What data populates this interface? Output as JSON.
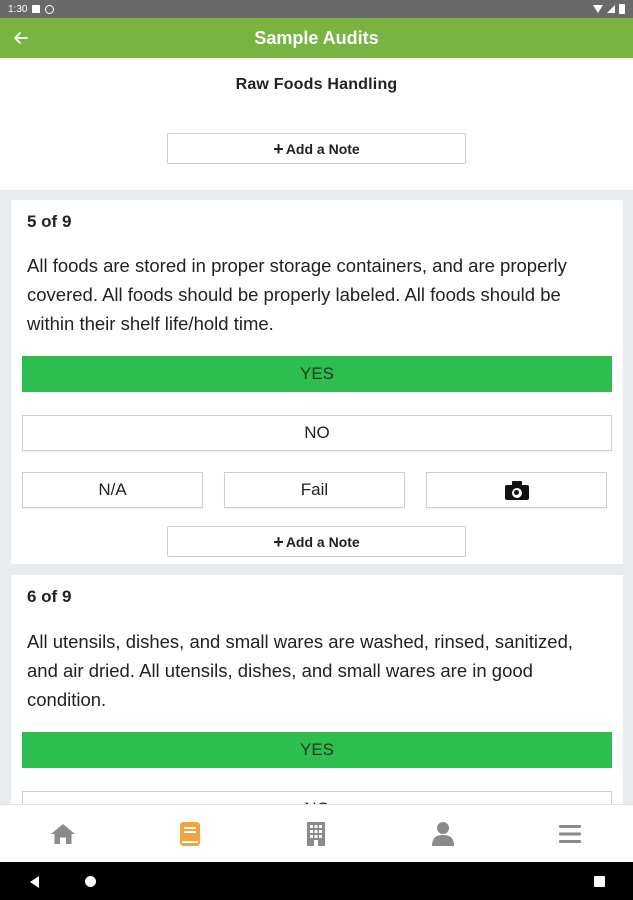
{
  "status_bar": {
    "time": "1:30"
  },
  "app_bar": {
    "title": "Sample Audits",
    "back_icon": "arrow-back-icon"
  },
  "section": {
    "title": "Raw Foods Handling",
    "add_note_label": "Add a Note"
  },
  "questions": [
    {
      "number": "5 of 9",
      "text": "All foods are stored in proper storage containers, and are properly covered. All foods should be properly labeled. All foods should be within their shelf life/hold time.",
      "yes_label": "YES",
      "no_label": "NO",
      "na_label": "N/A",
      "fail_label": "Fail",
      "add_note_label": "Add a Note",
      "selected": "YES"
    },
    {
      "number": "6 of 9",
      "text": "All utensils, dishes, and small wares are washed, rinsed, sanitized, and air dried. All utensils, dishes, and small wares are in good condition.",
      "yes_label": "YES",
      "no_label": "NO",
      "selected": "YES"
    }
  ],
  "bottom_nav": [
    {
      "icon": "home-icon",
      "active": false
    },
    {
      "icon": "book-icon",
      "active": true
    },
    {
      "icon": "building-icon",
      "active": false
    },
    {
      "icon": "person-icon",
      "active": false
    },
    {
      "icon": "menu-icon",
      "active": false
    }
  ],
  "colors": {
    "app_bar": "#79b342",
    "yes_selected": "#2dbe4f",
    "nav_active": "#f0a640",
    "nav_inactive": "#8a8a8a",
    "background": "#e8ecef"
  }
}
